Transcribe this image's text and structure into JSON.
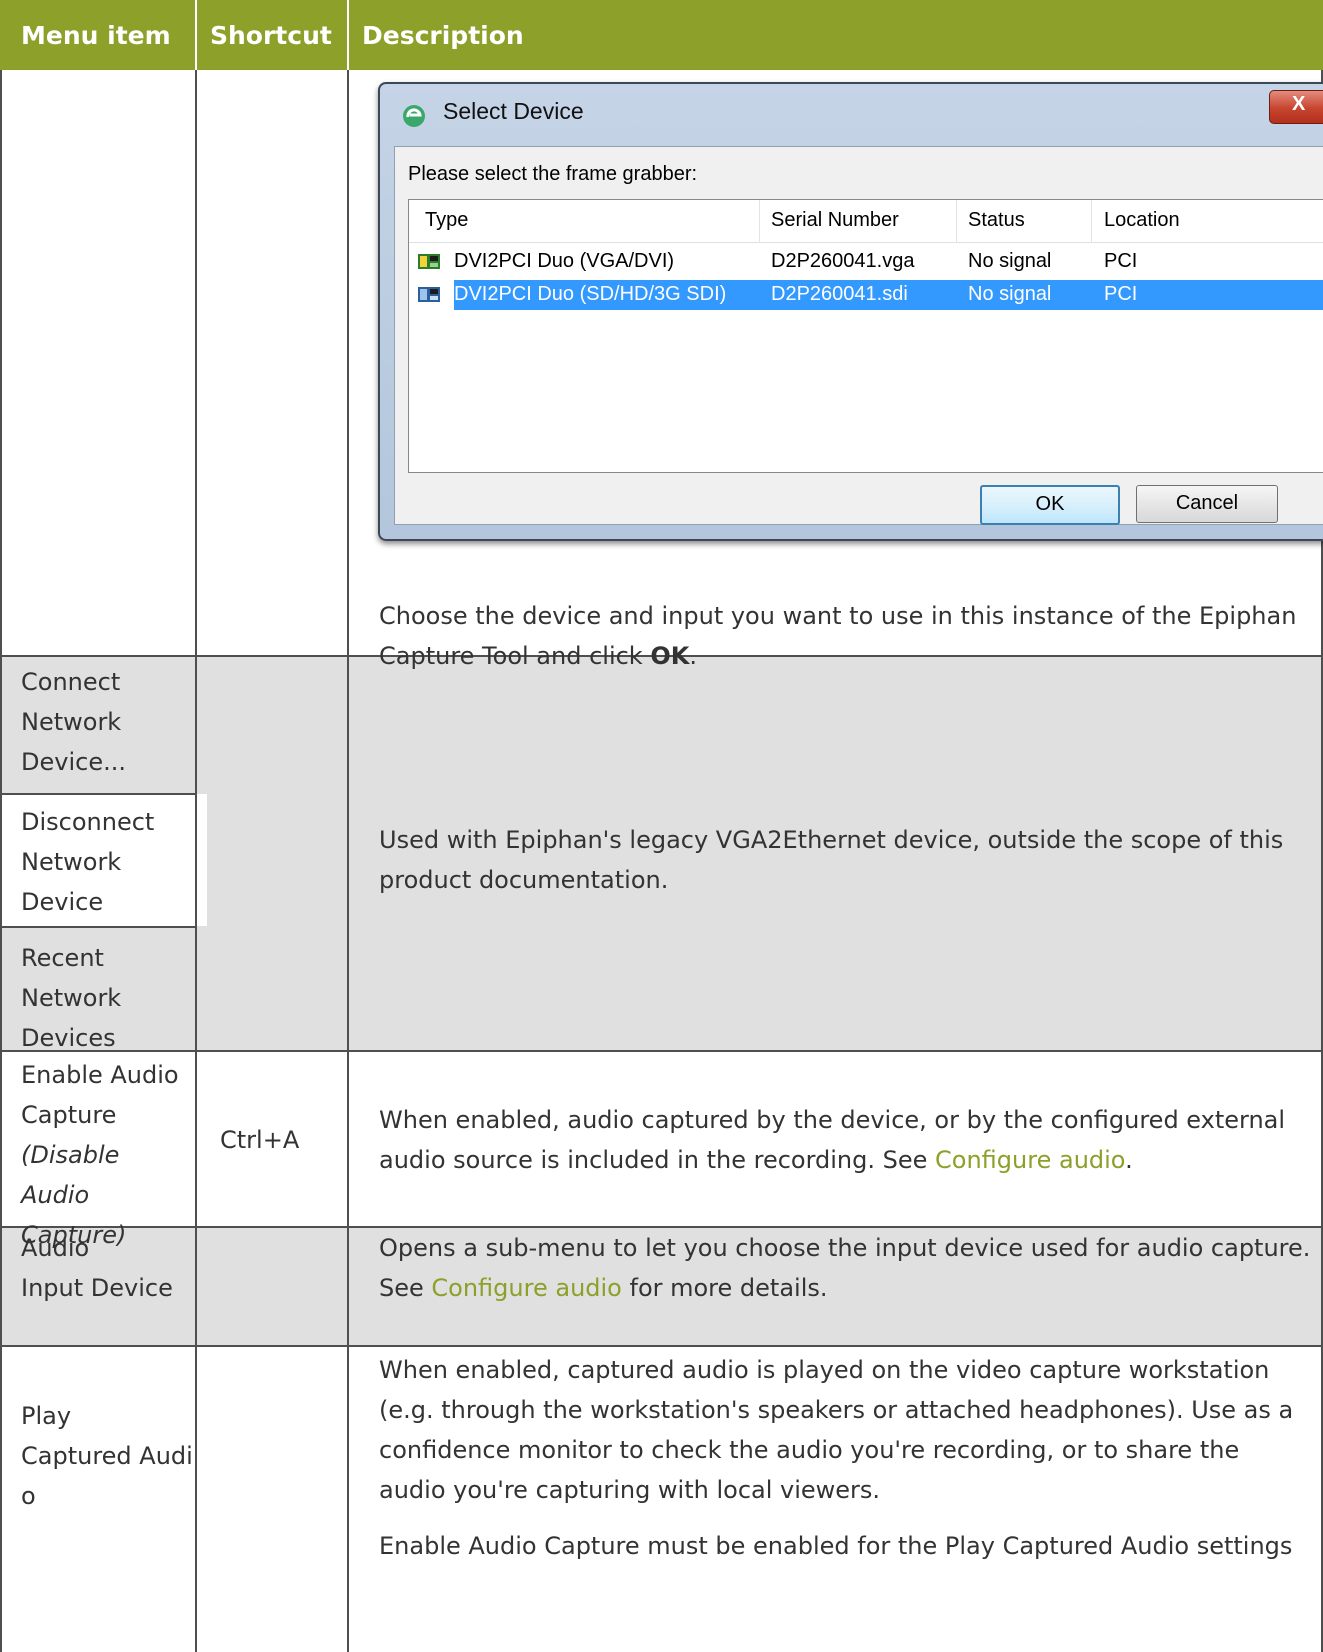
{
  "table": {
    "headers": [
      "Menu item",
      "Shortcut",
      "Description"
    ],
    "rows": {
      "select_device": {
        "description": [
          "Choose the device and input you want to use in this instance of the Epiphan",
          "Capture Tool and click "
        ],
        "description_bold": "OK",
        "description_end": "."
      },
      "connect_network": {
        "menu_item": [
          "Connect",
          "Network",
          "Device..."
        ]
      },
      "disconnect_network": {
        "menu_item": [
          "Disconnect",
          "Network",
          "Device"
        ]
      },
      "recent_network": {
        "menu_item": [
          "Recent",
          "Network",
          "Devices"
        ]
      },
      "network_description": [
        "Used with Epiphan's legacy VGA2Ethernet device, outside the scope of this",
        "product documentation."
      ],
      "enable_audio": {
        "menu_item": [
          "Enable Audio",
          "Capture"
        ],
        "menu_item_alt": [
          "(Disable Audio",
          "Capture)"
        ],
        "shortcut": "Ctrl+A",
        "description": [
          "When enabled, audio captured by the device, or by the configured external",
          "audio source is included in the recording. See "
        ],
        "link": "Configure audio",
        "description_end": "."
      },
      "audio_input": {
        "menu_item": [
          "Audio",
          "Input Device"
        ],
        "description": "Opens a sub-menu to let you choose the input device used for audio capture.",
        "description_pre": "See ",
        "link": "Configure audio",
        "description_end": " for more details."
      },
      "play_audio": {
        "menu_item": [
          "Play",
          "Captured Audi",
          "o"
        ],
        "description": [
          "When enabled, captured audio is played on the video capture workstation",
          "(e.g. through the workstation's speakers or attached headphones). Use as a",
          "confidence monitor to check the audio you're recording, or to share the",
          "audio you're capturing with local viewers."
        ],
        "description2": "Enable Audio Capture must be enabled for the Play Captured Audio settings"
      }
    }
  },
  "dialog": {
    "title": "Select Device",
    "close": "X",
    "prompt": "Please select the frame grabber:",
    "columns": [
      "Type",
      "Serial Number",
      "Status",
      "Location"
    ],
    "devices": [
      {
        "type": "DVI2PCI Duo (VGA/DVI)",
        "serial": "D2P260041.vga",
        "status": "No signal",
        "location": "PCI",
        "selected": false
      },
      {
        "type": "DVI2PCI Duo (SD/HD/3G SDI)",
        "serial": "D2P260041.sdi",
        "status": "No signal",
        "location": "PCI",
        "selected": true
      }
    ],
    "ok_label": "OK",
    "cancel_label": "Cancel"
  },
  "colors": {
    "header_bg": "#8ca02a",
    "link": "#8ca02a",
    "gray_row": "#e0e0e0",
    "selection": "#3399ff"
  }
}
